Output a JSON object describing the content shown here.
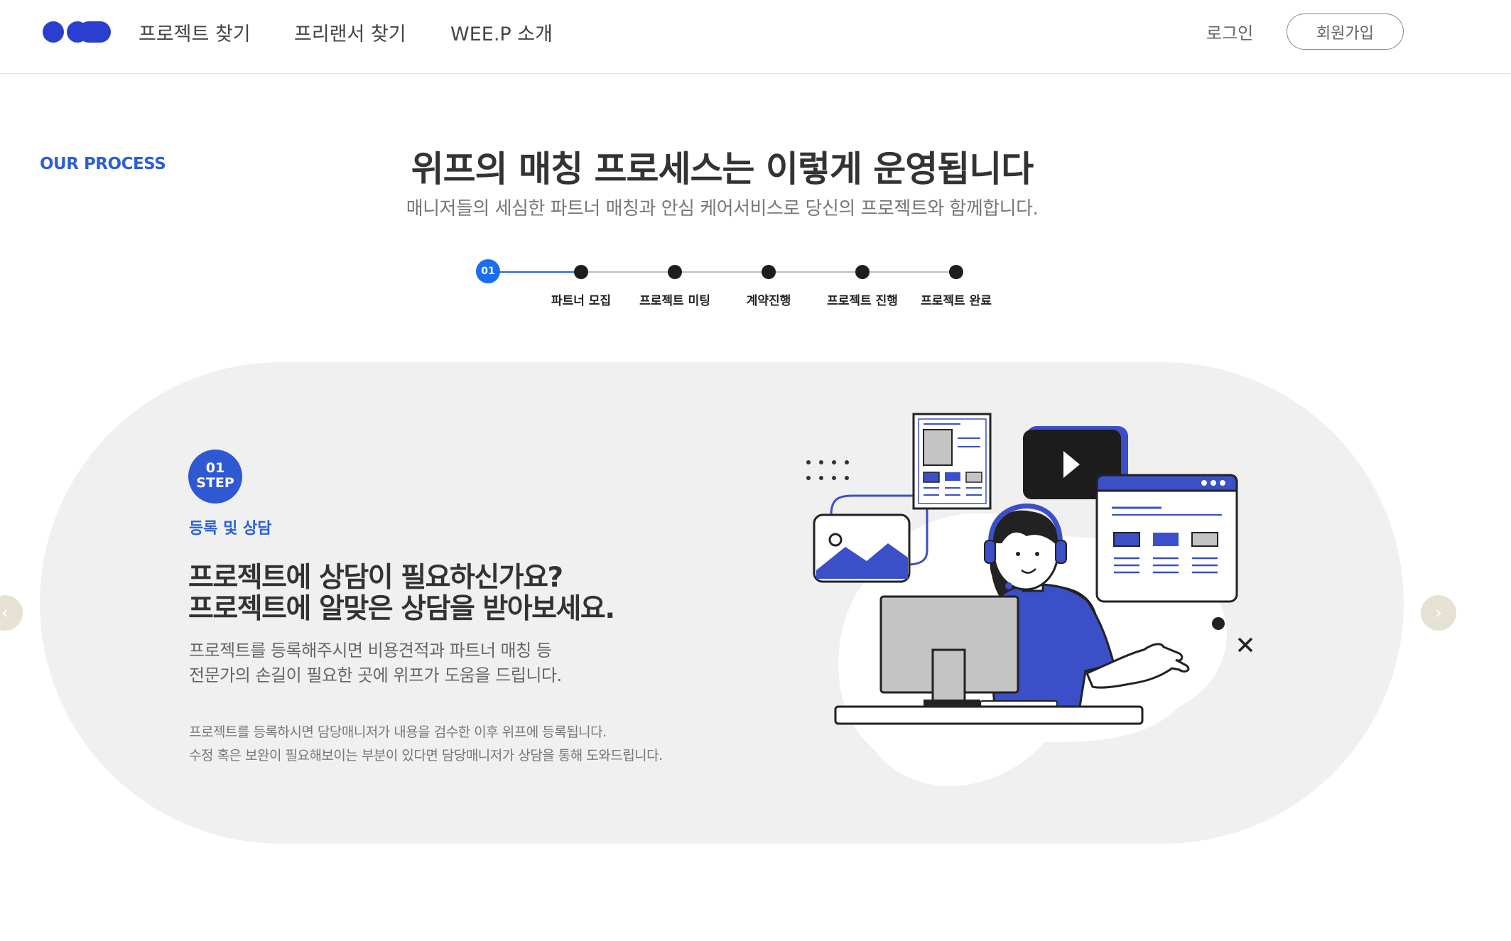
{
  "header": {
    "nav": [
      "프로젝트 찾기",
      "프리랜서 찾기",
      "WEE.P 소개"
    ],
    "login": "로그인",
    "signup": "회원가입"
  },
  "intro": {
    "label": "OUR PROCESS",
    "title": "위프의 매칭 프로세스는 이렇게 운영됩니다",
    "subtitle": "매니저들의 세심한 파트너 매칭과 안심 케어서비스로 당신의 프로젝트와 함께합니다."
  },
  "steps": {
    "current_number": "01",
    "labels": [
      "파트너 모집",
      "프로젝트 미팅",
      "계약진행",
      "프로젝트 진행",
      "프로젝트 완료"
    ]
  },
  "card": {
    "badge_number": "01",
    "badge_text": "STEP",
    "step_name": "등록 및 상담",
    "headline_1": "프로젝트에 상담이 필요하신가요?",
    "headline_2": "프로젝트에 알맞은 상담을 받아보세요.",
    "desc_1": "프로젝트를 등록해주시면 비용견적과 파트너 매칭 등",
    "desc_2": "전문가의 손길이 필요한 곳에 위프가 도움을 드립니다.",
    "note_1": "프로젝트를 등록하시면 담당매니저가 내용을 검수한 이후 위프에 등록됩니다.",
    "note_2": "수정 혹은 보완이 필요해보이는 부분이 있다면 담당매니저가 상담을 통해 도와드립니다."
  },
  "colors": {
    "accent": "#2d5fd6",
    "step_active": "#1a6cf0",
    "card_bg": "#eff0ef",
    "illustration_blue": "#3a4fc8",
    "arrow_bg": "#e6e2d3"
  },
  "icons": {
    "prev": "chevron-left-icon",
    "next": "chevron-right-icon"
  }
}
